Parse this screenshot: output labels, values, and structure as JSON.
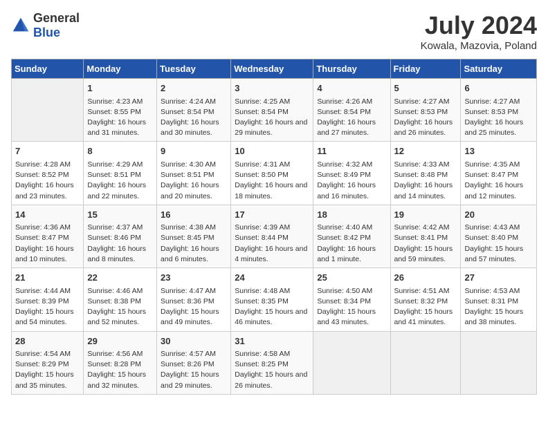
{
  "logo": {
    "general": "General",
    "blue": "Blue"
  },
  "header": {
    "month_year": "July 2024",
    "location": "Kowala, Mazovia, Poland"
  },
  "days_of_week": [
    "Sunday",
    "Monday",
    "Tuesday",
    "Wednesday",
    "Thursday",
    "Friday",
    "Saturday"
  ],
  "weeks": [
    [
      {
        "day": "",
        "sunrise": "",
        "sunset": "",
        "daylight": ""
      },
      {
        "day": "1",
        "sunrise": "Sunrise: 4:23 AM",
        "sunset": "Sunset: 8:55 PM",
        "daylight": "Daylight: 16 hours and 31 minutes."
      },
      {
        "day": "2",
        "sunrise": "Sunrise: 4:24 AM",
        "sunset": "Sunset: 8:54 PM",
        "daylight": "Daylight: 16 hours and 30 minutes."
      },
      {
        "day": "3",
        "sunrise": "Sunrise: 4:25 AM",
        "sunset": "Sunset: 8:54 PM",
        "daylight": "Daylight: 16 hours and 29 minutes."
      },
      {
        "day": "4",
        "sunrise": "Sunrise: 4:26 AM",
        "sunset": "Sunset: 8:54 PM",
        "daylight": "Daylight: 16 hours and 27 minutes."
      },
      {
        "day": "5",
        "sunrise": "Sunrise: 4:27 AM",
        "sunset": "Sunset: 8:53 PM",
        "daylight": "Daylight: 16 hours and 26 minutes."
      },
      {
        "day": "6",
        "sunrise": "Sunrise: 4:27 AM",
        "sunset": "Sunset: 8:53 PM",
        "daylight": "Daylight: 16 hours and 25 minutes."
      }
    ],
    [
      {
        "day": "7",
        "sunrise": "Sunrise: 4:28 AM",
        "sunset": "Sunset: 8:52 PM",
        "daylight": "Daylight: 16 hours and 23 minutes."
      },
      {
        "day": "8",
        "sunrise": "Sunrise: 4:29 AM",
        "sunset": "Sunset: 8:51 PM",
        "daylight": "Daylight: 16 hours and 22 minutes."
      },
      {
        "day": "9",
        "sunrise": "Sunrise: 4:30 AM",
        "sunset": "Sunset: 8:51 PM",
        "daylight": "Daylight: 16 hours and 20 minutes."
      },
      {
        "day": "10",
        "sunrise": "Sunrise: 4:31 AM",
        "sunset": "Sunset: 8:50 PM",
        "daylight": "Daylight: 16 hours and 18 minutes."
      },
      {
        "day": "11",
        "sunrise": "Sunrise: 4:32 AM",
        "sunset": "Sunset: 8:49 PM",
        "daylight": "Daylight: 16 hours and 16 minutes."
      },
      {
        "day": "12",
        "sunrise": "Sunrise: 4:33 AM",
        "sunset": "Sunset: 8:48 PM",
        "daylight": "Daylight: 16 hours and 14 minutes."
      },
      {
        "day": "13",
        "sunrise": "Sunrise: 4:35 AM",
        "sunset": "Sunset: 8:47 PM",
        "daylight": "Daylight: 16 hours and 12 minutes."
      }
    ],
    [
      {
        "day": "14",
        "sunrise": "Sunrise: 4:36 AM",
        "sunset": "Sunset: 8:47 PM",
        "daylight": "Daylight: 16 hours and 10 minutes."
      },
      {
        "day": "15",
        "sunrise": "Sunrise: 4:37 AM",
        "sunset": "Sunset: 8:46 PM",
        "daylight": "Daylight: 16 hours and 8 minutes."
      },
      {
        "day": "16",
        "sunrise": "Sunrise: 4:38 AM",
        "sunset": "Sunset: 8:45 PM",
        "daylight": "Daylight: 16 hours and 6 minutes."
      },
      {
        "day": "17",
        "sunrise": "Sunrise: 4:39 AM",
        "sunset": "Sunset: 8:44 PM",
        "daylight": "Daylight: 16 hours and 4 minutes."
      },
      {
        "day": "18",
        "sunrise": "Sunrise: 4:40 AM",
        "sunset": "Sunset: 8:42 PM",
        "daylight": "Daylight: 16 hours and 1 minute."
      },
      {
        "day": "19",
        "sunrise": "Sunrise: 4:42 AM",
        "sunset": "Sunset: 8:41 PM",
        "daylight": "Daylight: 15 hours and 59 minutes."
      },
      {
        "day": "20",
        "sunrise": "Sunrise: 4:43 AM",
        "sunset": "Sunset: 8:40 PM",
        "daylight": "Daylight: 15 hours and 57 minutes."
      }
    ],
    [
      {
        "day": "21",
        "sunrise": "Sunrise: 4:44 AM",
        "sunset": "Sunset: 8:39 PM",
        "daylight": "Daylight: 15 hours and 54 minutes."
      },
      {
        "day": "22",
        "sunrise": "Sunrise: 4:46 AM",
        "sunset": "Sunset: 8:38 PM",
        "daylight": "Daylight: 15 hours and 52 minutes."
      },
      {
        "day": "23",
        "sunrise": "Sunrise: 4:47 AM",
        "sunset": "Sunset: 8:36 PM",
        "daylight": "Daylight: 15 hours and 49 minutes."
      },
      {
        "day": "24",
        "sunrise": "Sunrise: 4:48 AM",
        "sunset": "Sunset: 8:35 PM",
        "daylight": "Daylight: 15 hours and 46 minutes."
      },
      {
        "day": "25",
        "sunrise": "Sunrise: 4:50 AM",
        "sunset": "Sunset: 8:34 PM",
        "daylight": "Daylight: 15 hours and 43 minutes."
      },
      {
        "day": "26",
        "sunrise": "Sunrise: 4:51 AM",
        "sunset": "Sunset: 8:32 PM",
        "daylight": "Daylight: 15 hours and 41 minutes."
      },
      {
        "day": "27",
        "sunrise": "Sunrise: 4:53 AM",
        "sunset": "Sunset: 8:31 PM",
        "daylight": "Daylight: 15 hours and 38 minutes."
      }
    ],
    [
      {
        "day": "28",
        "sunrise": "Sunrise: 4:54 AM",
        "sunset": "Sunset: 8:29 PM",
        "daylight": "Daylight: 15 hours and 35 minutes."
      },
      {
        "day": "29",
        "sunrise": "Sunrise: 4:56 AM",
        "sunset": "Sunset: 8:28 PM",
        "daylight": "Daylight: 15 hours and 32 minutes."
      },
      {
        "day": "30",
        "sunrise": "Sunrise: 4:57 AM",
        "sunset": "Sunset: 8:26 PM",
        "daylight": "Daylight: 15 hours and 29 minutes."
      },
      {
        "day": "31",
        "sunrise": "Sunrise: 4:58 AM",
        "sunset": "Sunset: 8:25 PM",
        "daylight": "Daylight: 15 hours and 26 minutes."
      },
      {
        "day": "",
        "sunrise": "",
        "sunset": "",
        "daylight": ""
      },
      {
        "day": "",
        "sunrise": "",
        "sunset": "",
        "daylight": ""
      },
      {
        "day": "",
        "sunrise": "",
        "sunset": "",
        "daylight": ""
      }
    ]
  ]
}
